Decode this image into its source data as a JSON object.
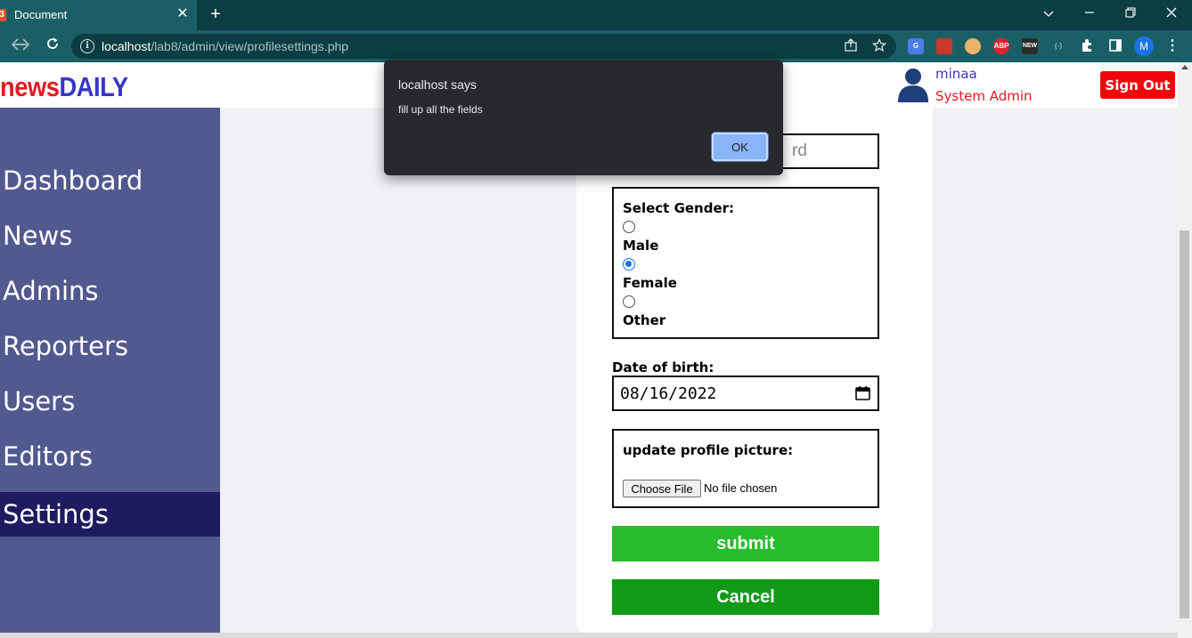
{
  "browser": {
    "tab_title": "Document",
    "tab_favicon_text": "3",
    "tab_close": "✕",
    "new_tab": "+",
    "url_host": "localhost",
    "url_path": "/lab8/admin/view/profilesettings.php",
    "profile_initial": "M",
    "extensions": [
      "translate-ext",
      "bookmark-ext",
      "reader-ext",
      "ABP",
      "NEW",
      "cast-ext"
    ]
  },
  "header": {
    "logo_news": "news",
    "logo_daily": "DAILY",
    "user_name": "minaa",
    "user_role": "System Admin",
    "signout_label": "Sign Out"
  },
  "sidebar": {
    "items": [
      {
        "label": "Dashboard",
        "active": false
      },
      {
        "label": "News",
        "active": false
      },
      {
        "label": "Admins",
        "active": false
      },
      {
        "label": "Reporters",
        "active": false
      },
      {
        "label": "Users",
        "active": false
      },
      {
        "label": "Editors",
        "active": false
      },
      {
        "label": "Settings",
        "active": true
      }
    ]
  },
  "form": {
    "password_placeholder_tail": "rd",
    "gender": {
      "label": "Select Gender:",
      "options": [
        {
          "label": "Male",
          "checked": false
        },
        {
          "label": "Female",
          "checked": true
        },
        {
          "label": "Other",
          "checked": false
        }
      ]
    },
    "dob_label": "Date of birth:",
    "dob_value": "08/16/2022",
    "picture_label": "update profile picture:",
    "choose_file_label": "Choose File",
    "no_file_text": "No file chosen",
    "submit_label": "submit",
    "cancel_label": "Cancel"
  },
  "dialog": {
    "title": "localhost says",
    "message": "fill up all the fields",
    "ok_label": "OK"
  },
  "colors": {
    "sidebar": "#52598f",
    "sidebar_active": "#1e1b60",
    "submit": "#27bd2c",
    "cancel": "#139a18",
    "signout": "#f2050a",
    "brand_red": "#e31b23",
    "brand_blue": "#3636c9"
  }
}
